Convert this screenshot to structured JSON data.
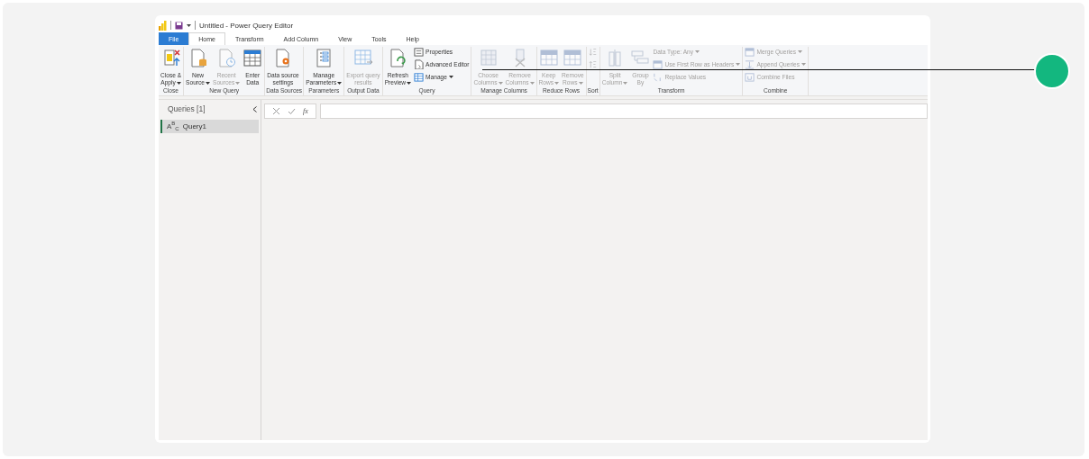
{
  "title_bar": {
    "title": "Untitled - Power Query Editor"
  },
  "tabs": [
    {
      "label": "File",
      "kind": "file",
      "selected": false
    },
    {
      "label": "Home",
      "kind": "tab",
      "selected": true
    },
    {
      "label": "Transform",
      "kind": "tab",
      "selected": false
    },
    {
      "label": "Add Column",
      "kind": "tab",
      "selected": false
    },
    {
      "label": "View",
      "kind": "tab",
      "selected": false
    },
    {
      "label": "Tools",
      "kind": "tab",
      "selected": false
    },
    {
      "label": "Help",
      "kind": "tab",
      "selected": false
    }
  ],
  "ribbon": {
    "groups": [
      {
        "label": "Close",
        "buttons": [
          {
            "kind": "large",
            "lines": [
              "Close &",
              "Apply"
            ],
            "dropdown": true,
            "disabled": false
          }
        ]
      },
      {
        "label": "New Query",
        "buttons": [
          {
            "kind": "large",
            "lines": [
              "New",
              "Source"
            ],
            "dropdown": true,
            "disabled": false
          },
          {
            "kind": "large",
            "lines": [
              "Recent",
              "Sources"
            ],
            "dropdown": true,
            "disabled": true
          },
          {
            "kind": "large",
            "lines": [
              "Enter",
              "Data"
            ],
            "dropdown": false,
            "disabled": false
          }
        ]
      },
      {
        "label": "Data Sources",
        "buttons": [
          {
            "kind": "large",
            "lines": [
              "Data source",
              "settings"
            ],
            "dropdown": false,
            "disabled": false
          }
        ]
      },
      {
        "label": "Parameters",
        "buttons": [
          {
            "kind": "large",
            "lines": [
              "Manage",
              "Parameters"
            ],
            "dropdown": true,
            "disabled": false
          }
        ]
      },
      {
        "label": "Output Data",
        "buttons": [
          {
            "kind": "large",
            "lines": [
              "Export query",
              "results"
            ],
            "dropdown": false,
            "disabled": true
          }
        ]
      },
      {
        "label": "Query",
        "buttons": [
          {
            "kind": "large",
            "lines": [
              "Refresh",
              "Preview"
            ],
            "dropdown": true,
            "disabled": false
          },
          {
            "kind": "small",
            "lines": [
              "Properties"
            ],
            "dropdown": false,
            "disabled": false
          },
          {
            "kind": "small",
            "lines": [
              "Advanced Editor"
            ],
            "dropdown": false,
            "disabled": false
          },
          {
            "kind": "small",
            "lines": [
              "Manage"
            ],
            "dropdown": true,
            "disabled": false
          }
        ]
      },
      {
        "label": "Manage Columns",
        "buttons": [
          {
            "kind": "large",
            "lines": [
              "Choose",
              "Columns"
            ],
            "dropdown": true,
            "disabled": true
          },
          {
            "kind": "large",
            "lines": [
              "Remove",
              "Columns"
            ],
            "dropdown": true,
            "disabled": true
          }
        ]
      },
      {
        "label": "Reduce Rows",
        "buttons": [
          {
            "kind": "large",
            "lines": [
              "Keep",
              "Rows"
            ],
            "dropdown": true,
            "disabled": true
          },
          {
            "kind": "large",
            "lines": [
              "Remove",
              "Rows"
            ],
            "dropdown": true,
            "disabled": true
          }
        ]
      },
      {
        "label": "Sort",
        "buttons": [
          {
            "kind": "icon",
            "disabled": true
          },
          {
            "kind": "icon",
            "disabled": true
          }
        ]
      },
      {
        "label": "Transform",
        "buttons": [
          {
            "kind": "large",
            "lines": [
              "Split",
              "Column"
            ],
            "dropdown": true,
            "disabled": true
          },
          {
            "kind": "large",
            "lines": [
              "Group",
              "By"
            ],
            "dropdown": false,
            "disabled": true
          },
          {
            "kind": "small",
            "lines": [
              "Data Type: Any"
            ],
            "dropdown": true,
            "disabled": true
          },
          {
            "kind": "small",
            "lines": [
              "Use First Row as Headers"
            ],
            "dropdown": true,
            "disabled": true
          },
          {
            "kind": "small",
            "lines": [
              "Replace Values"
            ],
            "dropdown": false,
            "disabled": true
          }
        ]
      },
      {
        "label": "Combine",
        "buttons": [
          {
            "kind": "small",
            "lines": [
              "Merge Queries"
            ],
            "dropdown": true,
            "disabled": true
          },
          {
            "kind": "small",
            "lines": [
              "Append Queries"
            ],
            "dropdown": true,
            "disabled": true
          },
          {
            "kind": "small",
            "lines": [
              "Combine Files"
            ],
            "dropdown": false,
            "disabled": true
          }
        ]
      }
    ]
  },
  "queries_pane": {
    "title": "Queries [1]",
    "items": [
      {
        "type_label": "A$^{B}$$_{C}$",
        "label": "Query1",
        "selected": true
      }
    ]
  },
  "formula_bar": {
    "fx_label": "fx"
  }
}
